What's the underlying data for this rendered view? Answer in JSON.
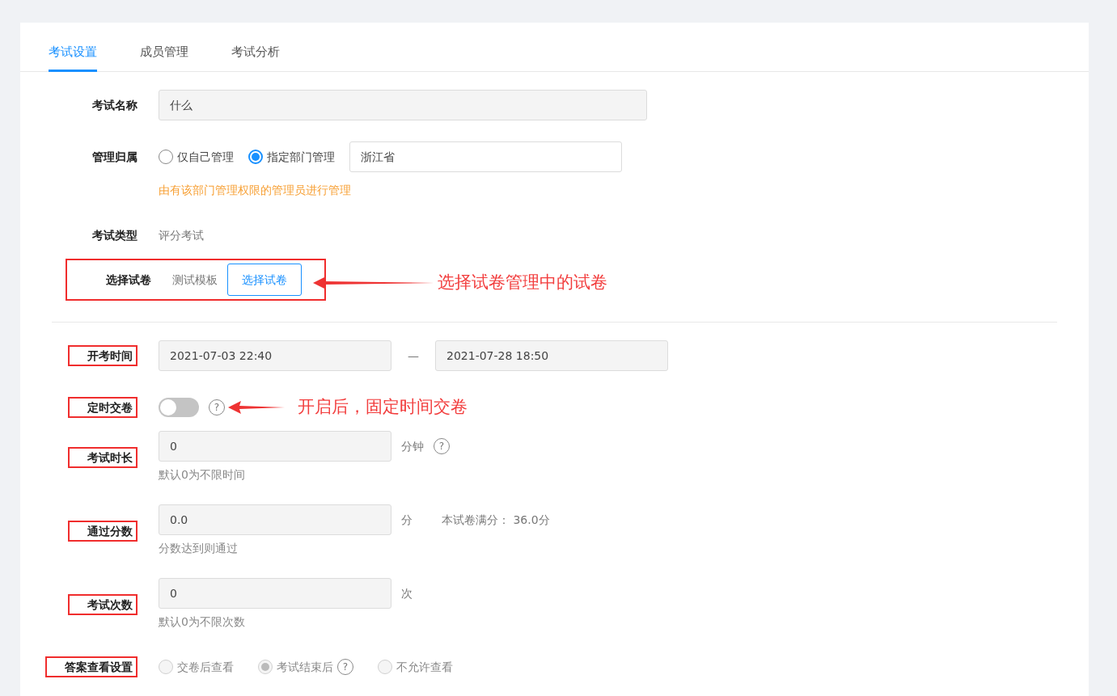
{
  "tabs": [
    {
      "label": "考试设置",
      "selected": true
    },
    {
      "label": "成员管理",
      "selected": false
    },
    {
      "label": "考试分析",
      "selected": false
    }
  ],
  "sections": [
    {
      "fields": [
        {
          "kind": "wide-input",
          "label": "考试名称",
          "value": "什么"
        },
        {
          "kind": "ownership",
          "label": "管理归属",
          "options": [
            {
              "label": "仅自己管理",
              "selected": false
            },
            {
              "label": "指定部门管理",
              "selected": true
            }
          ],
          "value": "浙江省",
          "hint": "由有该部门管理权限的管理员进行管理"
        },
        {
          "kind": "static",
          "label": "考试类型",
          "text": "评分考试"
        },
        {
          "kind": "paper",
          "label": "选择试卷",
          "text": "测试模板",
          "button": "选择试卷",
          "row_highlighted": true,
          "callout": "选择试卷管理中的试卷"
        }
      ]
    },
    {
      "fields": [
        {
          "kind": "range",
          "label": "开考时间",
          "start": "2021-07-03 22:40",
          "separator": "—",
          "end": "2021-07-28 18:50",
          "highlighted": true
        },
        {
          "kind": "switch",
          "label": "定时交卷",
          "on": false,
          "help": "?",
          "highlighted": true,
          "callout": "开启后，固定时间交卷"
        },
        {
          "kind": "input",
          "label": "考试时长",
          "value": "0",
          "unit": "分钟",
          "help": "?",
          "hint": "默认0为不限时间",
          "highlighted": true
        },
        {
          "kind": "input",
          "label": "通过分数",
          "value": "0.0",
          "unit": "分",
          "note": "本试卷满分： 36.0分",
          "hint": "分数达到则通过",
          "highlighted": true
        },
        {
          "kind": "input",
          "label": "考试次数",
          "value": "0",
          "unit": "次",
          "hint": "默认0为不限次数",
          "highlighted": true
        },
        {
          "kind": "radio",
          "label": "答案查看设置",
          "highlighted": true,
          "options": [
            {
              "label": "交卷后查看",
              "selected": false,
              "disabled": true
            },
            {
              "label": "考试结束后",
              "selected": true,
              "disabled": true,
              "help": "?"
            },
            {
              "label": "不允许查看",
              "selected": false,
              "disabled": true
            }
          ]
        }
      ]
    }
  ]
}
